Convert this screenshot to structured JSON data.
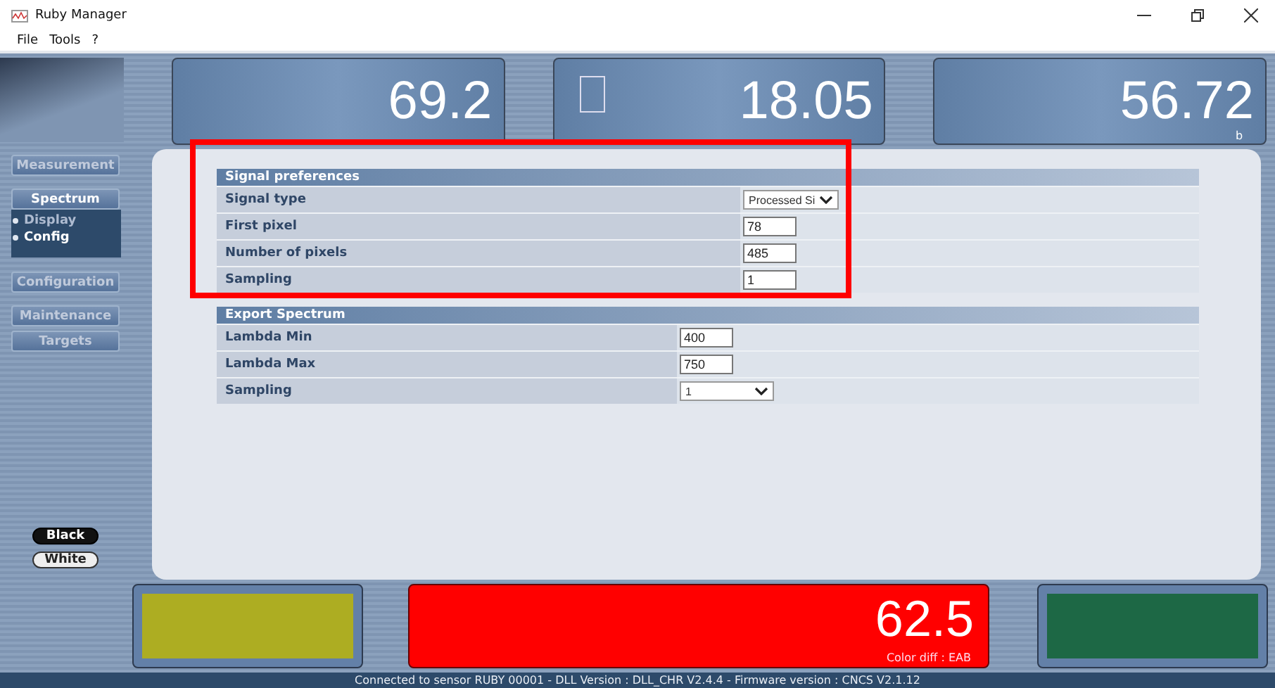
{
  "window": {
    "title": "Ruby Manager"
  },
  "menu": [
    "File",
    "Tools",
    "?"
  ],
  "readouts": [
    {
      "value": "69.2",
      "kind": "plain"
    },
    {
      "value": "18.05",
      "kind": "swatch"
    },
    {
      "value": "56.72",
      "kind": "plain",
      "caption": "b"
    }
  ],
  "sidebar": {
    "items": [
      {
        "label": "Measurement",
        "selected": false
      },
      {
        "label": "Spectrum",
        "selected": true,
        "children": [
          {
            "label": "Display",
            "selected": false
          },
          {
            "label": "Config",
            "selected": true
          }
        ]
      },
      {
        "label": "Configuration",
        "selected": false
      },
      {
        "label": "Maintenance",
        "selected": false
      },
      {
        "label": "Targets",
        "selected": false
      }
    ],
    "background_buttons": [
      {
        "label": "Black",
        "kind": "dark"
      },
      {
        "label": "White",
        "kind": "light"
      }
    ]
  },
  "sections": [
    {
      "title": "Signal preferences",
      "rows": [
        {
          "label": "Signal type",
          "kind": "select",
          "value": "Processed Si"
        },
        {
          "label": "First pixel",
          "kind": "input",
          "value": "78"
        },
        {
          "label": "Number of pixels",
          "kind": "input",
          "value": "485"
        },
        {
          "label": "Sampling",
          "kind": "input",
          "value": "1"
        }
      ]
    },
    {
      "title": "Export Spectrum",
      "rows": [
        {
          "label": "Lambda Min",
          "kind": "input",
          "value": "400"
        },
        {
          "label": "Lambda Max",
          "kind": "input",
          "value": "750"
        },
        {
          "label": "Sampling",
          "kind": "select",
          "value": "1"
        }
      ]
    }
  ],
  "annotations": [
    {
      "kind": "frame"
    }
  ],
  "comparison": {
    "left_swatch": {
      "color": "#adad22"
    },
    "difference": {
      "value": "62.5",
      "caption": "Color diff : EAB"
    },
    "right_swatch": {
      "color": "#1d6845"
    }
  },
  "status_bar": "Connected to sensor RUBY 00001 - DLL Version : DLL_CHR V2.4.4 - Firmware version : CNCS V2.1.12"
}
